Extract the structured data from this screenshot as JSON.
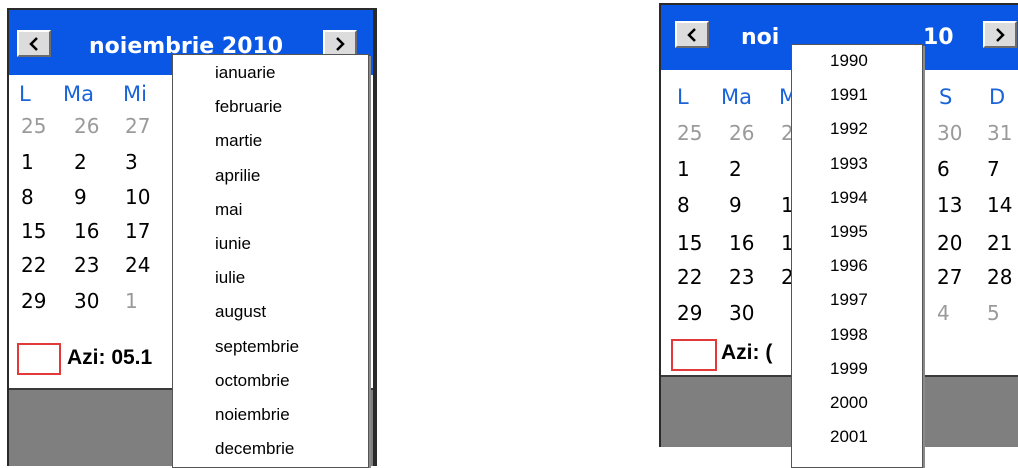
{
  "left_calendar": {
    "title": "noiembrie 2010",
    "prev_glyph": "‹",
    "next_glyph": "›",
    "weekdays": [
      "L",
      "Ma",
      "Mi"
    ],
    "weeks": [
      [
        "25",
        "26",
        "27"
      ],
      [
        "1",
        "2",
        "3"
      ],
      [
        "8",
        "9",
        "10"
      ],
      [
        "15",
        "16",
        "17"
      ],
      [
        "22",
        "23",
        "24"
      ],
      [
        "29",
        "30",
        "1"
      ]
    ],
    "today_label": "Azi: 05.1",
    "month_dropdown": [
      "ianuarie",
      "februarie",
      "martie",
      "aprilie",
      "mai",
      "iunie",
      "iulie",
      "august",
      "septembrie",
      "octombrie",
      "noiembrie",
      "decembrie"
    ]
  },
  "right_calendar": {
    "title_left": "noi",
    "title_right": "10",
    "weekdays_left": [
      "L",
      "Ma",
      "M"
    ],
    "weekdays_right": [
      "S",
      "D"
    ],
    "weeks_left": [
      [
        "25",
        "26",
        "2"
      ],
      [
        "1",
        "2",
        ""
      ],
      [
        "8",
        "9",
        "1"
      ],
      [
        "15",
        "16",
        "1"
      ],
      [
        "22",
        "23",
        "2"
      ],
      [
        "29",
        "30",
        ""
      ]
    ],
    "weeks_right": [
      [
        "30",
        "31"
      ],
      [
        "6",
        "7"
      ],
      [
        "13",
        "14"
      ],
      [
        "20",
        "21"
      ],
      [
        "27",
        "28"
      ],
      [
        "4",
        "5"
      ]
    ],
    "today_label": "Azi: (",
    "year_dropdown": [
      "1990",
      "1991",
      "1992",
      "1993",
      "1994",
      "1995",
      "1996",
      "1997",
      "1998",
      "1999",
      "2000",
      "2001"
    ]
  },
  "colors": {
    "header_blue": "#0a57e6",
    "weekday_blue": "#1a63d8",
    "today_red": "#e23a3a",
    "footer_gray": "#7f7f7f"
  }
}
